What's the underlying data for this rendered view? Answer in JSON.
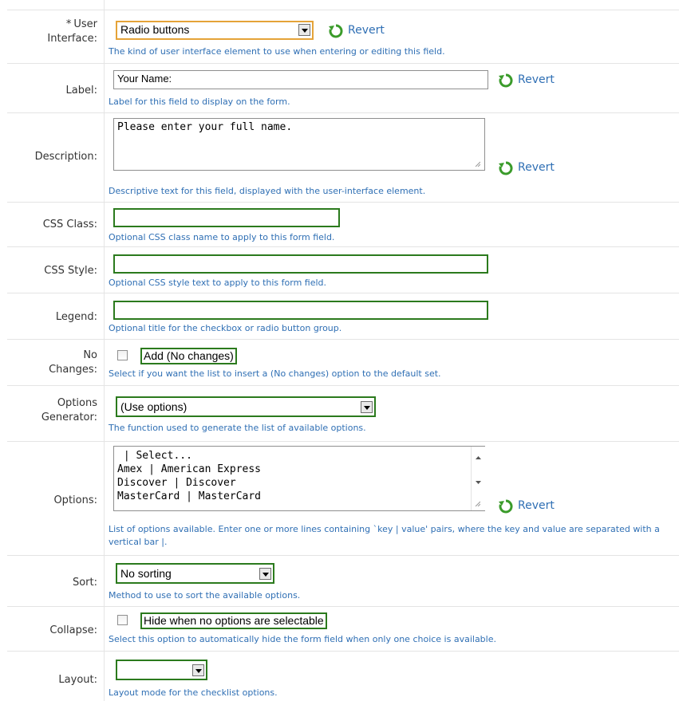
{
  "revert_label": "Revert",
  "fields": {
    "user_interface": {
      "required_mark": "*",
      "label_line1": "User",
      "label_line2": "Interface:",
      "value": "Radio buttons",
      "help": "The kind of user interface element to use when entering or editing this field."
    },
    "label": {
      "label": "Label:",
      "value": "Your Name:",
      "help": "Label for this field to display on the form."
    },
    "description": {
      "label": "Description:",
      "value": "Please enter your full name.",
      "help": "Descriptive text for this field, displayed with the user-interface element."
    },
    "css_class": {
      "label": "CSS Class:",
      "value": "",
      "help": "Optional CSS class name to apply to this form field."
    },
    "css_style": {
      "label": "CSS Style:",
      "value": "",
      "help": "Optional CSS style text to apply to this form field."
    },
    "legend": {
      "label": "Legend:",
      "value": "",
      "help": "Optional title for the checkbox or radio button group."
    },
    "no_changes": {
      "label_line1": "No",
      "label_line2": "Changes:",
      "checkbox_label": "Add (No changes)",
      "checked": false,
      "help": "Select if you want the list to insert a (No changes) option to the default set."
    },
    "options_generator": {
      "label_line1": "Options",
      "label_line2": "Generator:",
      "value": "(Use options)",
      "help": "The function used to generate the list of available options."
    },
    "options": {
      "label": "Options:",
      "value": " | Select...\nAmex | American Express\nDiscover | Discover\nMasterCard | MasterCard",
      "help": "List of options available. Enter one or more lines containing `key | value' pairs, where the key and value are separated with a vertical bar |."
    },
    "sort": {
      "label": "Sort:",
      "value": "No sorting",
      "help": "Method to use to sort the available options."
    },
    "collapse": {
      "label": "Collapse:",
      "checkbox_label": "Hide when no options are selectable",
      "checked": false,
      "help": "Select this option to automatically hide the form field when only one choice is available."
    },
    "layout": {
      "label": "Layout:",
      "value": "",
      "help": "Layout mode for the checklist options."
    }
  },
  "colors": {
    "help_text": "#2f6fb4",
    "highlight_green": "#2b7a1d",
    "highlight_orange": "#e5a338",
    "revert_icon_green": "#3a9b2a"
  }
}
